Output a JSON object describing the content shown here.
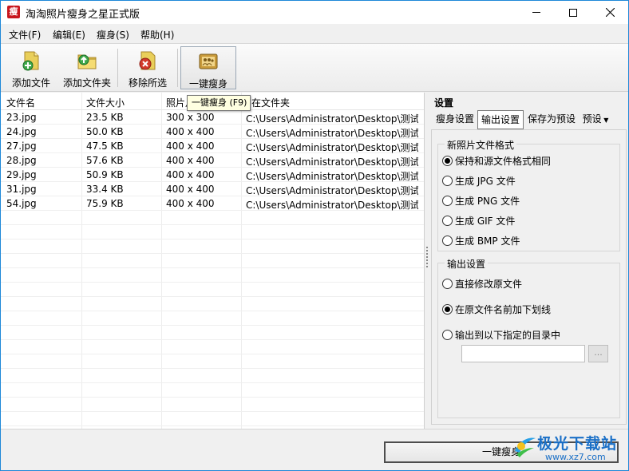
{
  "window": {
    "title": "淘淘照片瘦身之星正式版",
    "icon_char": "瘦"
  },
  "menu": [
    "文件(F)",
    "编辑(E)",
    "瘦身(S)",
    "帮助(H)"
  ],
  "toolbar": {
    "add_file": "添加文件",
    "add_folder": "添加文件夹",
    "remove_selected": "移除所选",
    "one_click": "一键瘦身"
  },
  "tooltip": "一键瘦身 (F9)",
  "table": {
    "headers": [
      "文件名",
      "文件大小",
      "照片尺寸",
      "所在文件夹"
    ],
    "header_visible": [
      "文件名",
      "文件大小",
      "照片月",
      "在文件夹"
    ],
    "rows": [
      {
        "name": "23.jpg",
        "size": "23.5 KB",
        "dims": "300 x 300",
        "folder": "C:\\Users\\Administrator\\Desktop\\测试..."
      },
      {
        "name": "24.jpg",
        "size": "50.0 KB",
        "dims": "400 x 400",
        "folder": "C:\\Users\\Administrator\\Desktop\\测试..."
      },
      {
        "name": "27.jpg",
        "size": "47.5 KB",
        "dims": "400 x 400",
        "folder": "C:\\Users\\Administrator\\Desktop\\测试..."
      },
      {
        "name": "28.jpg",
        "size": "57.6 KB",
        "dims": "400 x 400",
        "folder": "C:\\Users\\Administrator\\Desktop\\测试..."
      },
      {
        "name": "29.jpg",
        "size": "50.9 KB",
        "dims": "400 x 400",
        "folder": "C:\\Users\\Administrator\\Desktop\\测试..."
      },
      {
        "name": "31.jpg",
        "size": "33.4 KB",
        "dims": "400 x 400",
        "folder": "C:\\Users\\Administrator\\Desktop\\测试..."
      },
      {
        "name": "54.jpg",
        "size": "75.9 KB",
        "dims": "400 x 400",
        "folder": "C:\\Users\\Administrator\\Desktop\\测试..."
      }
    ]
  },
  "settings": {
    "title": "设置",
    "tabs": [
      "瘦身设置",
      "输出设置",
      "保存为预设",
      "预设"
    ],
    "active_tab": "输出设置",
    "format_group": {
      "label": "新照片文件格式",
      "options": [
        "保持和源文件格式相同",
        "生成 JPG 文件",
        "生成 PNG 文件",
        "生成 GIF 文件",
        "生成 BMP 文件"
      ],
      "selected": 0
    },
    "output_group": {
      "label": "输出设置",
      "options": [
        "直接修改原文件",
        "在原文件名前加下划线",
        "输出到以下指定的目录中"
      ],
      "selected": 1
    },
    "path_value": "",
    "browse_label": "..."
  },
  "bottom": {
    "run_button": "一键瘦身"
  },
  "watermark": {
    "name": "极光下载站",
    "url": "www.xz7.com"
  }
}
